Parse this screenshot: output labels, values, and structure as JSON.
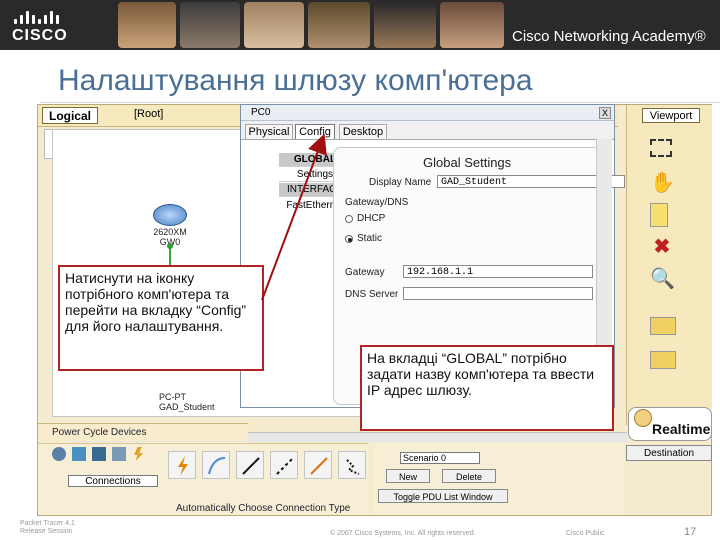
{
  "banner": {
    "logo_text": "CISCO",
    "academy": "Cisco Networking Academy®"
  },
  "title": "Налаштування шлюзу комп'ютера",
  "pt": {
    "logical_tab": "Logical",
    "root_label": "[Root]",
    "router_label": "2620XM\nGW0",
    "pc_label": "PC-PT\nGAD_Student",
    "power_cycle": "Power Cycle Devices",
    "connections": "Connections",
    "auto_connection": "Automatically Choose Connection Type",
    "viewport": "Viewport",
    "realtime": "Realtime",
    "scenario": "Scenario 0",
    "new_btn": "New",
    "delete_btn": "Delete",
    "toggle_pdu": "Toggle PDU List Window",
    "desc_header": "Destination"
  },
  "window": {
    "title": "PC0",
    "close": "X",
    "tabs": [
      "Physical",
      "Config",
      "Desktop"
    ],
    "side_items": [
      "GLOBAL",
      "Settings",
      "INTERFACE",
      "FastEthernet"
    ],
    "settings_title": "Global Settings",
    "display_name_label": "Display Name",
    "display_name_value": "GAD_Student",
    "gateway_group": "Gateway/DNS",
    "dhcp": "DHCP",
    "static": "Static",
    "gateway_label": "Gateway",
    "gateway_value": "192.168.1.1",
    "dns_label": "DNS Server",
    "dns_value": ""
  },
  "callouts": {
    "one": "Натиснути на іконку потрібного комп'ютера та перейти на вкладку “Config”  для його налаштування.",
    "two": "На вкладці “GLOBAL” потрібно задати назву комп'ютера та ввести IP адрес шлюзу."
  },
  "footer": {
    "left": "Packet Tracer 4.1\nRelease Session",
    "center": "© 2007 Cisco Systems, Inc. All rights reserved.",
    "right": "Cisco Public",
    "page": "17"
  },
  "colors": {
    "title": "#4a6f95",
    "callout_border": "#b22222",
    "arrow": "#a01010"
  }
}
